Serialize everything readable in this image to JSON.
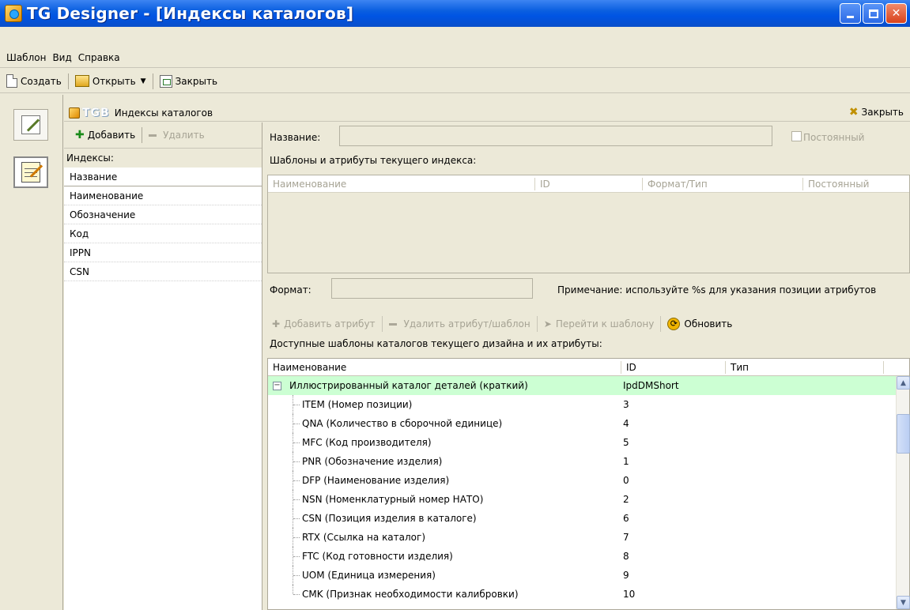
{
  "window": {
    "title": "TG Designer - [Индексы каталогов]"
  },
  "menu": [
    "Шаблон",
    "Вид",
    "Справка"
  ],
  "toolbar": {
    "create": "Создать",
    "open": "Открыть",
    "close": "Закрыть"
  },
  "doc": {
    "logo": "TGB",
    "title": "Индексы каталогов",
    "close": "Закрыть"
  },
  "index_panel": {
    "add": "Добавить",
    "remove": "Удалить",
    "label": "Индексы:",
    "header": "Название",
    "items": [
      "Наименование",
      "Обозначение",
      "Код",
      "IPPN",
      "CSN"
    ]
  },
  "form": {
    "name_label": "Название:",
    "permanent_label": "Постоянный",
    "templates_label": "Шаблоны и атрибуты текущего индекса:",
    "grid_cols": [
      "Наименование",
      "ID",
      "Формат/Тип",
      "Постоянный"
    ],
    "format_label": "Формат:",
    "note": "Примечание: используйте %s для указания позиции атрибутов"
  },
  "attr_toolbar": {
    "add": "Добавить атрибут",
    "remove": "Удалить атрибут/шаблон",
    "goto": "Перейти к шаблону",
    "refresh": "Обновить"
  },
  "available": {
    "label": "Доступные шаблоны каталогов текущего дизайна и их атрибуты:",
    "cols": [
      "Наименование",
      "ID",
      "Тип"
    ],
    "root": {
      "name": "Иллюстрированный каталог деталей (краткий)",
      "id": "IpdDMShort",
      "expander": "−"
    },
    "rows": [
      {
        "name": "ITEM (Номер позиции)",
        "id": "3"
      },
      {
        "name": "QNA (Количество в сборочной единице)",
        "id": "4"
      },
      {
        "name": "MFC (Код производителя)",
        "id": "5"
      },
      {
        "name": "PNR (Обозначение изделия)",
        "id": "1"
      },
      {
        "name": "DFP (Наименование изделия)",
        "id": "0"
      },
      {
        "name": "NSN (Номенклатурный номер НАТО)",
        "id": "2"
      },
      {
        "name": "CSN (Позиция изделия в каталоге)",
        "id": "6"
      },
      {
        "name": "RTX (Ссылка на каталог)",
        "id": "7"
      },
      {
        "name": "FTC (Код готовности изделия)",
        "id": "8"
      },
      {
        "name": "UOM (Единица измерения)",
        "id": "9"
      },
      {
        "name": "CMK (Признак необходимости калибровки)",
        "id": "10"
      }
    ]
  }
}
